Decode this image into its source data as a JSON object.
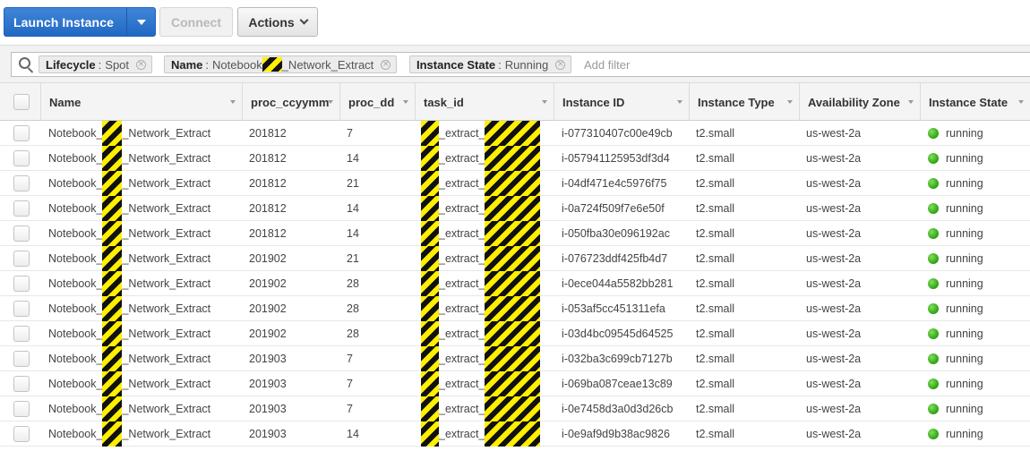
{
  "toolbar": {
    "launch_label": "Launch Instance",
    "connect_label": "Connect",
    "actions_label": "Actions"
  },
  "filters": {
    "chips": [
      {
        "key": "Lifecycle",
        "sep": ":",
        "value": "Spot"
      },
      {
        "key": "Name",
        "sep": ":",
        "value_prefix": "Notebook",
        "value_suffix": "_Network_Extract"
      },
      {
        "key": "Instance State",
        "sep": ":",
        "value": "Running"
      }
    ],
    "add_filter": "Add filter"
  },
  "table": {
    "columns": [
      "Name",
      "proc_ccyymm",
      "proc_dd",
      "task_id",
      "Instance ID",
      "Instance Type",
      "Availability Zone",
      "Instance State"
    ],
    "name_prefix": "Notebook_",
    "name_suffix": "_Network_Extract",
    "task_mid": "_extract_",
    "rows": [
      {
        "ccyymm": "201812",
        "dd": "7",
        "instance_id": "i-077310407c00e49cb",
        "type": "t2.small",
        "zone": "us-west-2a",
        "state": "running"
      },
      {
        "ccyymm": "201812",
        "dd": "14",
        "instance_id": "i-057941125953df3d4",
        "type": "t2.small",
        "zone": "us-west-2a",
        "state": "running"
      },
      {
        "ccyymm": "201812",
        "dd": "21",
        "instance_id": "i-04df471e4c5976f75",
        "type": "t2.small",
        "zone": "us-west-2a",
        "state": "running"
      },
      {
        "ccyymm": "201812",
        "dd": "14",
        "instance_id": "i-0a724f509f7e6e50f",
        "type": "t2.small",
        "zone": "us-west-2a",
        "state": "running"
      },
      {
        "ccyymm": "201812",
        "dd": "14",
        "instance_id": "i-050fba30e096192ac",
        "type": "t2.small",
        "zone": "us-west-2a",
        "state": "running"
      },
      {
        "ccyymm": "201902",
        "dd": "21",
        "instance_id": "i-076723ddf425fb4d7",
        "type": "t2.small",
        "zone": "us-west-2a",
        "state": "running"
      },
      {
        "ccyymm": "201902",
        "dd": "28",
        "instance_id": "i-0ece044a5582bb281",
        "type": "t2.small",
        "zone": "us-west-2a",
        "state": "running"
      },
      {
        "ccyymm": "201902",
        "dd": "28",
        "instance_id": "i-053af5cc451311efa",
        "type": "t2.small",
        "zone": "us-west-2a",
        "state": "running"
      },
      {
        "ccyymm": "201902",
        "dd": "28",
        "instance_id": "i-03d4bc09545d64525",
        "type": "t2.small",
        "zone": "us-west-2a",
        "state": "running"
      },
      {
        "ccyymm": "201903",
        "dd": "7",
        "instance_id": "i-032ba3c699cb7127b",
        "type": "t2.small",
        "zone": "us-west-2a",
        "state": "running"
      },
      {
        "ccyymm": "201903",
        "dd": "7",
        "instance_id": "i-069ba087ceae13c89",
        "type": "t2.small",
        "zone": "us-west-2a",
        "state": "running"
      },
      {
        "ccyymm": "201903",
        "dd": "7",
        "instance_id": "i-0e7458d3a0d3d26cb",
        "type": "t2.small",
        "zone": "us-west-2a",
        "state": "running"
      },
      {
        "ccyymm": "201903",
        "dd": "14",
        "instance_id": "i-0e9af9d9b38ac9826",
        "type": "t2.small",
        "zone": "us-west-2a",
        "state": "running"
      }
    ]
  },
  "colors": {
    "primary_button": "#2168c4",
    "running_status": "#3cb11b",
    "redaction_stripe": "#ffef00"
  }
}
